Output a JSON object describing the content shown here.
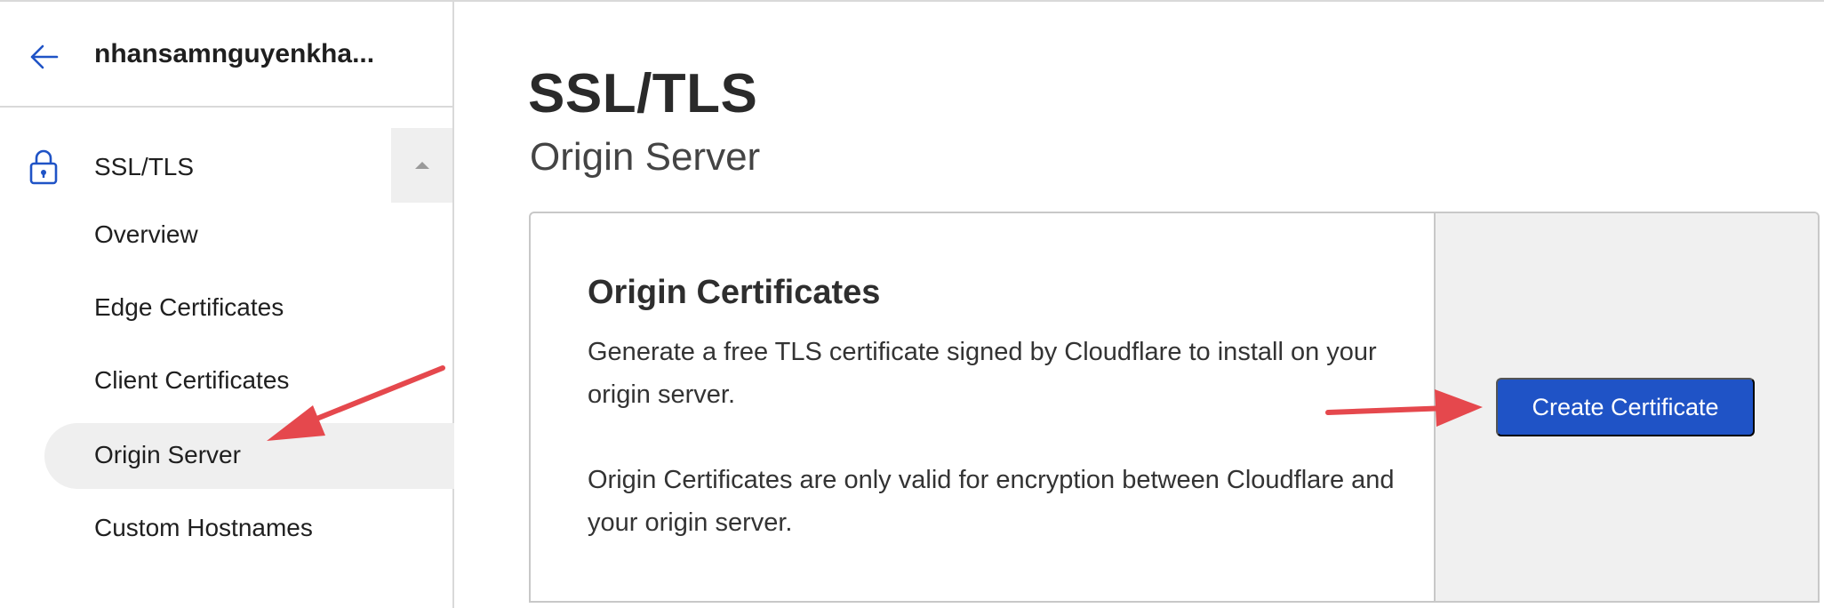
{
  "sidebar": {
    "zone_name": "nhansamnguyenkha...",
    "back_icon": "arrow-left-icon",
    "section": {
      "label": "SSL/TLS",
      "icon": "lock-icon",
      "expanded": true
    },
    "items": [
      {
        "label": "Overview",
        "active": false
      },
      {
        "label": "Edge Certificates",
        "active": false
      },
      {
        "label": "Client Certificates",
        "active": false
      },
      {
        "label": "Origin Server",
        "active": true
      },
      {
        "label": "Custom Hostnames",
        "active": false
      }
    ]
  },
  "main": {
    "title": "SSL/TLS",
    "subtitle": "Origin Server",
    "card": {
      "title": "Origin Certificates",
      "description_1": "Generate a free TLS certificate signed by Cloudflare to install on your origin server.",
      "description_2": "Origin Certificates are only valid for encryption between Cloudflare and your origin server.",
      "button_label": "Create Certificate"
    }
  },
  "colors": {
    "accent": "#1f53c6",
    "annotation_arrow": "#e5484d",
    "active_bg": "#efefef"
  }
}
